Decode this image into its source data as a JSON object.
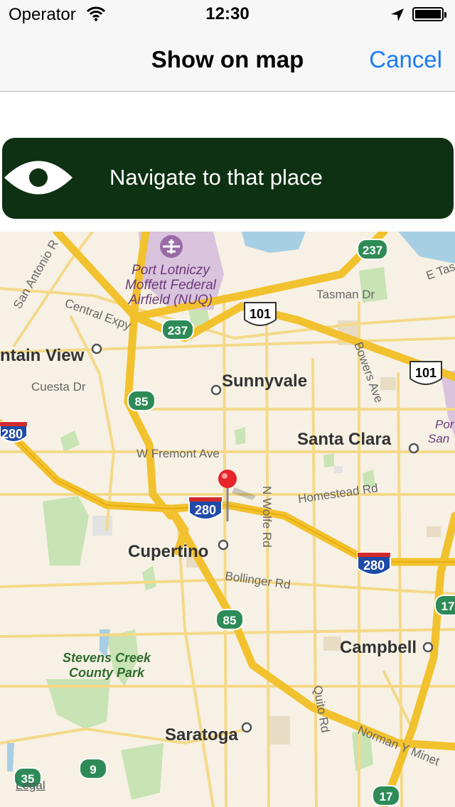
{
  "status_bar": {
    "carrier": "Operator",
    "time": "12:30",
    "wifi_icon": "wifi-icon",
    "location_icon": "location-arrow-icon",
    "battery_icon": "battery-icon",
    "battery_level": 1.0
  },
  "nav_bar": {
    "title": "Show on map",
    "cancel_label": "Cancel",
    "accent_color": "#1a7cf4"
  },
  "navigate_button": {
    "label": "Navigate to that place",
    "icon": "eye-icon",
    "background_color": "#0f3113"
  },
  "map": {
    "legal_label": "Legal",
    "pin_icon": "map-pin-icon",
    "cities": [
      "Sunnyvale",
      "Santa Clara",
      "Cupertino",
      "Campbell",
      "Saratoga",
      "ntain View"
    ],
    "airport": [
      "Port Lotniczy",
      "Moffett Federal",
      "Airfield (NUQ)"
    ],
    "airport_partial": [
      "Por",
      "San"
    ],
    "park": [
      "Stevens Creek",
      "County Park"
    ],
    "streets": [
      "Central Expy",
      "San Antonio R",
      "Tasman Dr",
      "E Tas",
      "Cuesta Dr",
      "W Fremont Ave",
      "Bowers Ave",
      "N Wolfe Rd",
      "Homestead Rd",
      "Bollinger Rd",
      "Quito Rd",
      "Norman Y Minet"
    ],
    "shields": {
      "interstate": [
        "280",
        "280",
        "280"
      ],
      "us": [
        "101",
        "101"
      ],
      "state": [
        "237",
        "237",
        "85",
        "85",
        "35",
        "9",
        "17",
        "17"
      ]
    }
  }
}
